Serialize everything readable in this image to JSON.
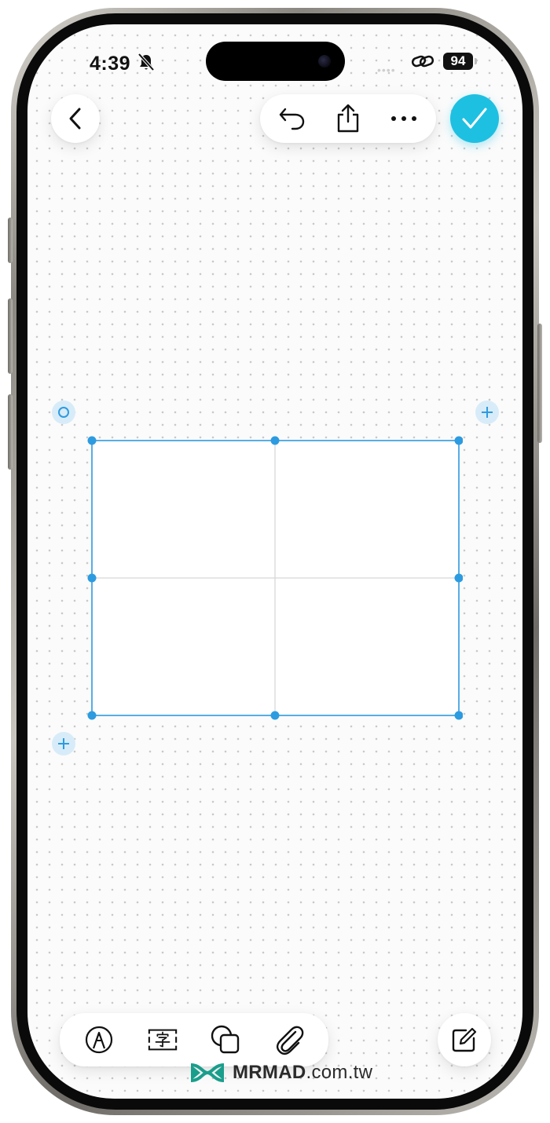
{
  "status_bar": {
    "time": "4:39",
    "battery": "94",
    "signal": "••••"
  },
  "toolbar": {
    "back_icon": "chevron-left-icon",
    "undo_icon": "undo-icon",
    "share_icon": "share-icon",
    "more_icon": "ellipsis-icon",
    "done_icon": "checkmark-icon",
    "accent_color": "#1ec0e2"
  },
  "canvas": {
    "background": "dot-grid",
    "table": {
      "rows": 2,
      "columns": 2,
      "selection_color": "#2d9be0"
    },
    "controls": [
      "circle-handle",
      "add-column",
      "add-row"
    ]
  },
  "bottom_toolbar": {
    "tools": [
      "pen-tool-icon",
      "text-box-icon",
      "shapes-icon",
      "attachment-icon"
    ],
    "compose_icon": "compose-icon"
  },
  "watermark": {
    "brand": "MRMAD",
    "domain": ".com.tw"
  }
}
